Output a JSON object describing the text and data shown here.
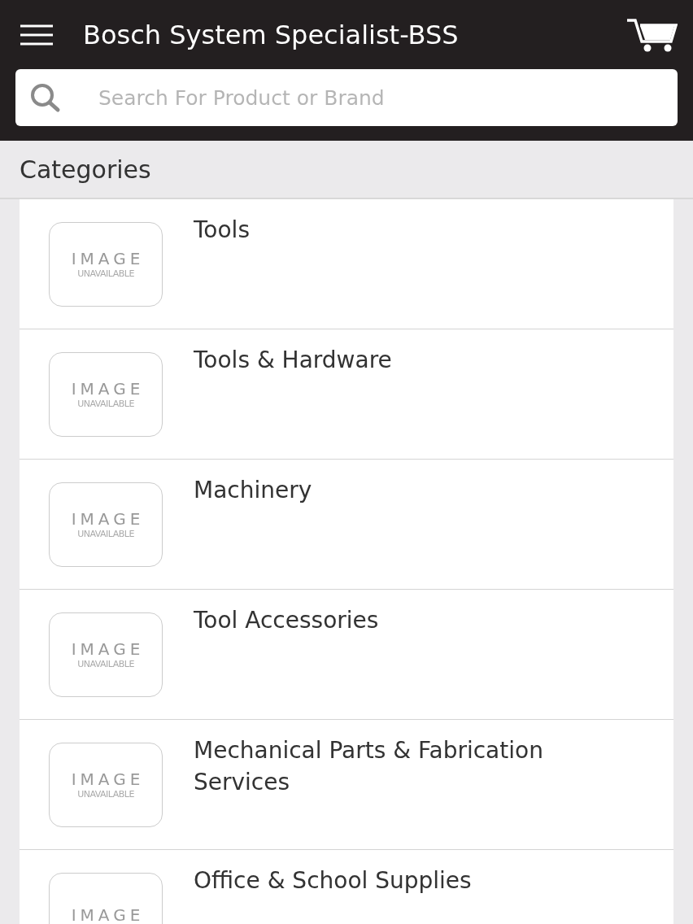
{
  "header": {
    "title": "Bosch System Specialist-BSS"
  },
  "search": {
    "placeholder": "Search For Product or Brand"
  },
  "section": {
    "title": "Categories"
  },
  "categories": [
    {
      "name": "Tools",
      "image_text": "IMAGE",
      "image_subtext": "UNAVAILABLE"
    },
    {
      "name": "Tools & Hardware",
      "image_text": "IMAGE",
      "image_subtext": "UNAVAILABLE"
    },
    {
      "name": "Machinery",
      "image_text": "IMAGE",
      "image_subtext": "UNAVAILABLE"
    },
    {
      "name": "Tool Accessories",
      "image_text": "IMAGE",
      "image_subtext": "UNAVAILABLE"
    },
    {
      "name": "Mechanical Parts & Fabrication Services",
      "image_text": "IMAGE",
      "image_subtext": "UNAVAILABLE"
    },
    {
      "name": "Office & School Supplies",
      "image_text": "IMAGE"
    }
  ]
}
